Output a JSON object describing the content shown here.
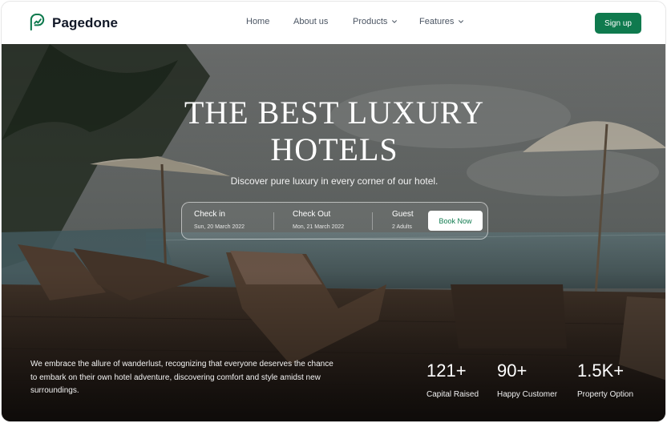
{
  "brand": {
    "name": "Pagedone",
    "logo_icon": "pagedone-logo-icon",
    "accent": "#0f7a4e"
  },
  "nav": {
    "items": [
      {
        "label": "Home",
        "has_dropdown": false
      },
      {
        "label": "About us",
        "has_dropdown": false
      },
      {
        "label": "Products",
        "has_dropdown": true
      },
      {
        "label": "Features",
        "has_dropdown": true
      }
    ],
    "signup_label": "Sign up"
  },
  "hero": {
    "title_line1": "THE BEST LUXURY",
    "title_line2": "HOTELS",
    "subtitle": "Discover pure luxury in every corner of our hotel."
  },
  "booking": {
    "check_in": {
      "label": "Check in",
      "value": "Sun, 20 March 2022"
    },
    "check_out": {
      "label": "Check Out",
      "value": "Mon, 21 March 2022"
    },
    "guest": {
      "label": "Guest",
      "value": "2 Adults"
    },
    "book_label": "Book Now"
  },
  "tagline": "We embrace the allure of wanderlust, recognizing that everyone deserves the chance to embark on their own hotel adventure, discovering comfort and style amidst new surroundings.",
  "stats": [
    {
      "value": "121+",
      "caption": "Capital Raised"
    },
    {
      "value": "90+",
      "caption": "Happy Customer"
    },
    {
      "value": "1.5K+",
      "caption": "Property Option"
    }
  ]
}
